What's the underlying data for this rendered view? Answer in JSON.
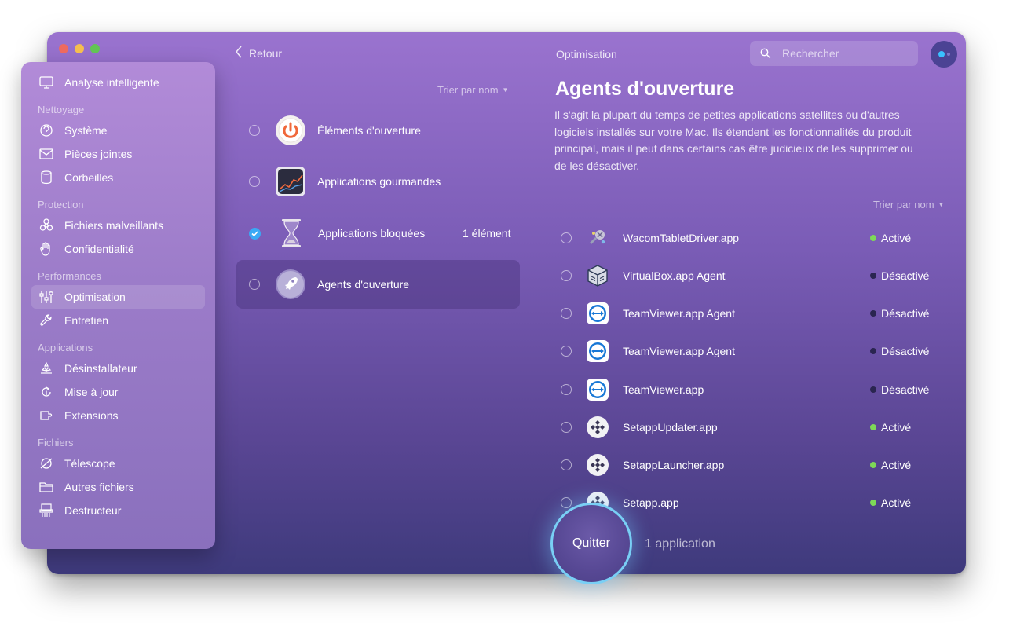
{
  "header": {
    "back_label": "Retour",
    "section_title": "Optimisation",
    "search_placeholder": "Rechercher"
  },
  "sidebar": {
    "top_item": "Analyse intelligente",
    "sections": [
      {
        "title": "Nettoyage",
        "items": [
          "Système",
          "Pièces jointes",
          "Corbeilles"
        ]
      },
      {
        "title": "Protection",
        "items": [
          "Fichiers malveillants",
          "Confidentialité"
        ]
      },
      {
        "title": "Performances",
        "items": [
          "Optimisation",
          "Entretien"
        ]
      },
      {
        "title": "Applications",
        "items": [
          "Désinstallateur",
          "Mise à jour",
          "Extensions"
        ]
      },
      {
        "title": "Fichiers",
        "items": [
          "Télescope",
          "Autres fichiers",
          "Destructeur"
        ]
      }
    ],
    "active_item": "Optimisation"
  },
  "categories": {
    "sort_label": "Trier par nom",
    "items": [
      {
        "label": "Éléments d'ouverture",
        "count": "",
        "checked": false,
        "icon": "power-icon"
      },
      {
        "label": "Applications gourmandes",
        "count": "",
        "checked": false,
        "icon": "activity-chart-icon"
      },
      {
        "label": "Applications bloquées",
        "count": "1 élément",
        "checked": true,
        "icon": "hourglass-icon"
      },
      {
        "label": "Agents d'ouverture",
        "count": "",
        "checked": false,
        "icon": "rocket-icon"
      }
    ],
    "active_index": 3
  },
  "detail": {
    "title": "Agents d'ouverture",
    "description": "Il s'agit la plupart du temps de petites applications satellites ou d'autres logiciels installés sur votre Mac. Ils étendent les fonctionnalités du produit principal, mais il peut dans certains cas être judicieux de les supprimer ou de les désactiver.",
    "sort_label": "Trier par nom",
    "agents": [
      {
        "name": "WacomTabletDriver.app",
        "status": "Activé",
        "enabled": true,
        "icon": "wacom-icon"
      },
      {
        "name": "VirtualBox.app Agent",
        "status": "Désactivé",
        "enabled": false,
        "icon": "virtualbox-icon"
      },
      {
        "name": "TeamViewer.app Agent",
        "status": "Désactivé",
        "enabled": false,
        "icon": "teamviewer-icon"
      },
      {
        "name": "TeamViewer.app Agent",
        "status": "Désactivé",
        "enabled": false,
        "icon": "teamviewer-icon"
      },
      {
        "name": "TeamViewer.app",
        "status": "Désactivé",
        "enabled": false,
        "icon": "teamviewer-icon"
      },
      {
        "name": "SetappUpdater.app",
        "status": "Activé",
        "enabled": true,
        "icon": "setapp-icon"
      },
      {
        "name": "SetappLauncher.app",
        "status": "Activé",
        "enabled": true,
        "icon": "setapp-icon"
      },
      {
        "name": "Setapp.app",
        "status": "Activé",
        "enabled": true,
        "icon": "setapp-icon"
      }
    ]
  },
  "footer": {
    "quit_label": "Quitter",
    "selection_note": "1 application"
  },
  "colors": {
    "active_status": "#7ed957",
    "inactive_status": "#2a2550",
    "accent_blue": "#3aa9f5",
    "quit_ring": "#79cff5"
  }
}
